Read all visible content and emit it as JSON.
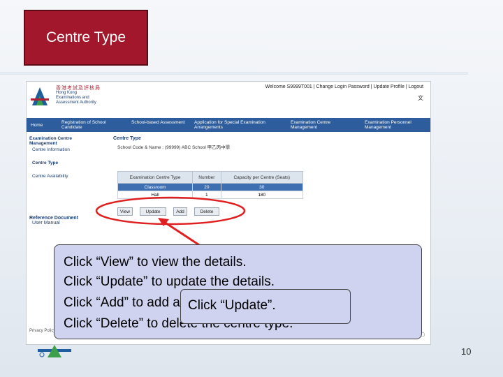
{
  "slide": {
    "title": "Centre Type",
    "page_number": "10"
  },
  "header": {
    "logo_cn": "香港考試及評核局",
    "logo_en_1": "Hong Kong",
    "logo_en_2": "Examinations and",
    "logo_en_3": "Assessment Authority",
    "top_links": "Welcome S9999T001 | Change Login Password | Update Profile | Logout",
    "lang": "文"
  },
  "nav": {
    "items": [
      "Home",
      "Registration of School Candidate",
      "School-based Assessment",
      "Application for Special Examination Arrangements",
      "Examination Centre Management",
      "Examination Personnel Management"
    ]
  },
  "sidebar": {
    "heading": "Examination Centre Management",
    "centre_info": "Centre Information",
    "centre_type": "Centre Type",
    "centre_availability": "Centre Availability",
    "ref_heading": "Reference Document",
    "user_manual": "User Manual"
  },
  "content": {
    "title": "Centre Type",
    "school_label": "School Code & Name :",
    "school_code": "(99999)",
    "school_name": "ABC School",
    "school_name_cn": "甲乙丙中學",
    "table": {
      "headers": [
        "Examination Centre Type",
        "Number",
        "Capacity per Centre (Seats)"
      ],
      "rows": [
        [
          "Classroom",
          "20",
          "30"
        ],
        [
          "Hall",
          "1",
          "180"
        ]
      ]
    },
    "buttons": {
      "view": "View",
      "update": "Update",
      "add": "Add",
      "delete": "Delete"
    }
  },
  "footer": {
    "privacy": "Privacy Policy"
  },
  "callout": {
    "line1": "Click “View” to view the details.",
    "line2": "Click “Update” to update the details.",
    "line3": "Click “Add” to add a centre type.",
    "line4": "Click “Delete” to delete the centre type.",
    "popup": "Click “Update”."
  },
  "colors": {
    "title_bg": "#a2172b",
    "nav_bg": "#2d5d9c",
    "highlight": "#e02020",
    "callout_bg": "#cfd3f0"
  }
}
